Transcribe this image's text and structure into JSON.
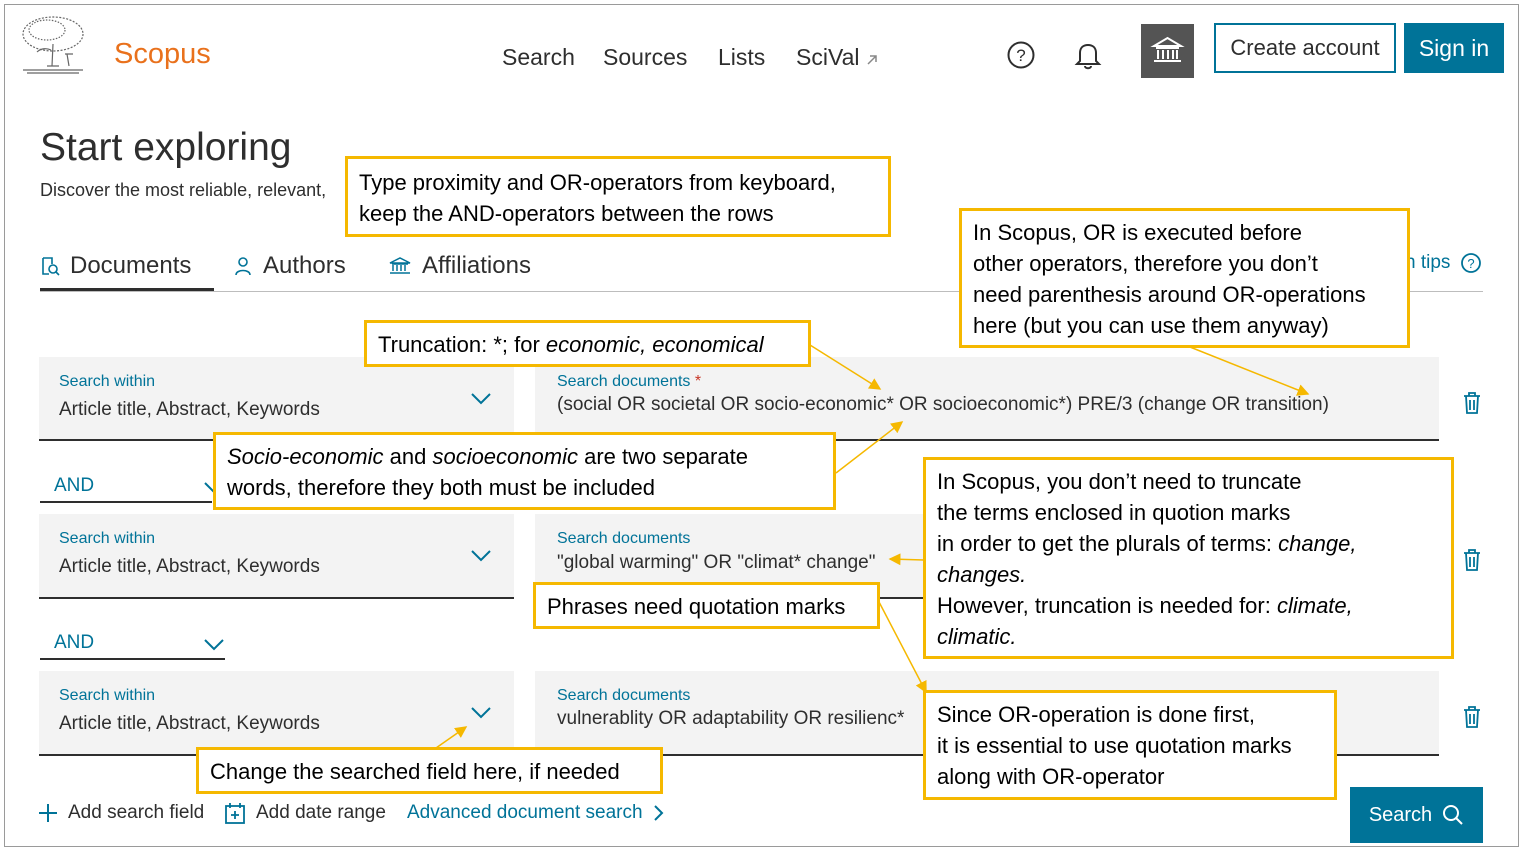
{
  "header": {
    "brand": "Scopus",
    "nav": [
      "Search",
      "Sources",
      "Lists",
      "SciVal"
    ],
    "nav_external_icon": "external-arrow-icon",
    "help_icon": "help-circle-icon",
    "bell_icon": "bell-icon",
    "institution_icon": "institution-icon",
    "create_account": "Create account",
    "sign_in": "Sign in"
  },
  "page": {
    "title": "Start exploring",
    "subtitle": "Discover the most reliable, relevant,"
  },
  "tabs": [
    {
      "label": "Documents",
      "icon": "document-search-icon",
      "active": true
    },
    {
      "label": "Authors",
      "icon": "person-icon",
      "active": false
    },
    {
      "label": "Affiliations",
      "icon": "institution-icon",
      "active": false
    }
  ],
  "tips": {
    "label": "n tips",
    "icon": "help-circle-icon"
  },
  "rows": [
    {
      "within_label": "Search within",
      "within_value": "Article title, Abstract, Keywords",
      "docs_label": "Search documents",
      "required_mark": "*",
      "query": "(social OR societal OR socio-economic* OR socioeconomic*)  PRE/3  (change OR transition)"
    },
    {
      "operator": "AND",
      "within_label": "Search within",
      "within_value": "Article title, Abstract, Keywords",
      "docs_label": "Search documents",
      "query": "\"global warming\" OR \"climat* change\""
    },
    {
      "operator": "AND",
      "within_label": "Search within",
      "within_value": "Article title, Abstract, Keywords",
      "docs_label": "Search documents",
      "query": "vulnerablity OR adaptability OR resilienc*"
    }
  ],
  "bottom": {
    "add_field": "Add search field",
    "add_date": "Add date range",
    "advanced": "Advanced document search",
    "search_button": "Search"
  },
  "notes": {
    "n1": [
      "Type proximity and OR-operators from keyboard,",
      "keep the AND-operators between the rows"
    ],
    "n2": [
      "In Scopus, OR is executed before",
      "other operators, therefore you don’t",
      "need parenthesis around OR-operations",
      "here (but you can use them anyway)"
    ],
    "n3_prefix": "Truncation: *; for ",
    "n3_italic": "economic, economical",
    "n4": {
      "i1": "Socio-economic",
      "t1": " and ",
      "i2": "socioeconomic",
      "t2": " are two separate",
      "line2": "words, therefore they both must be included"
    },
    "n5": {
      "l1": "In Scopus, you don’t need to truncate",
      "l2": "the terms enclosed in quotion marks",
      "l3": "in order to get the plurals of terms: ",
      "l3i": "change,",
      "l4i": "changes.",
      "l5": "However, truncation is needed for: ",
      "l5i": "climate,",
      "l6i": "climatic."
    },
    "n6": "Phrases need quotation marks",
    "n7": [
      "Since OR-operation is done first,",
      "it is essential to use quotation marks",
      "along with OR-operator"
    ],
    "n8": "Change the searched field here, if needed"
  },
  "colors": {
    "accent": "#007398",
    "brand": "#e9711c",
    "note_border": "#f5b800"
  }
}
